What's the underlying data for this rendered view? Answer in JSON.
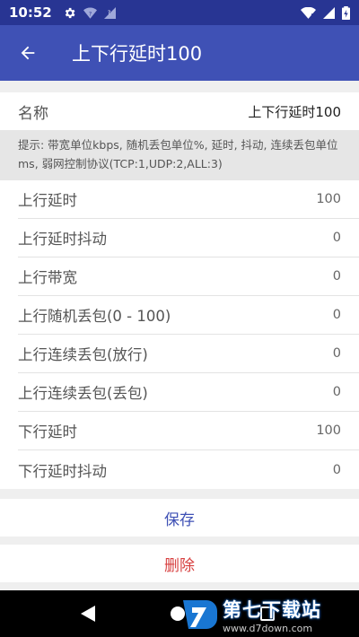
{
  "status_bar": {
    "time": "10:52",
    "left_icons": [
      "gear-icon",
      "wifi-question-icon",
      "signal-question-icon"
    ],
    "right_icons": [
      "wifi-icon",
      "signal-icon",
      "battery-charging-icon"
    ]
  },
  "app_bar": {
    "back_icon": "arrow-back-icon",
    "title": "上下行延时100"
  },
  "name_row": {
    "label": "名称",
    "value": "上下行延时100"
  },
  "hint": "提示: 带宽单位kbps, 随机丢包单位%, 延时, 抖动, 连续丢包单位ms, 弱网控制协议(TCP:1,UDP:2,ALL:3)",
  "params": [
    {
      "label": "上行延时",
      "value": "100"
    },
    {
      "label": "上行延时抖动",
      "value": "0"
    },
    {
      "label": "上行带宽",
      "value": "0"
    },
    {
      "label": "上行随机丢包(0 - 100)",
      "value": "0"
    },
    {
      "label": "上行连续丢包(放行)",
      "value": "0"
    },
    {
      "label": "上行连续丢包(丢包)",
      "value": "0"
    },
    {
      "label": "下行延时",
      "value": "100"
    },
    {
      "label": "下行延时抖动",
      "value": "0"
    }
  ],
  "actions": {
    "save": "保存",
    "delete": "删除"
  },
  "watermark": {
    "title": "第七下载站",
    "url": "www.d7down.com"
  },
  "colors": {
    "primary": "#3f51b5",
    "primary_dark": "#283593",
    "delete": "#d74040"
  }
}
